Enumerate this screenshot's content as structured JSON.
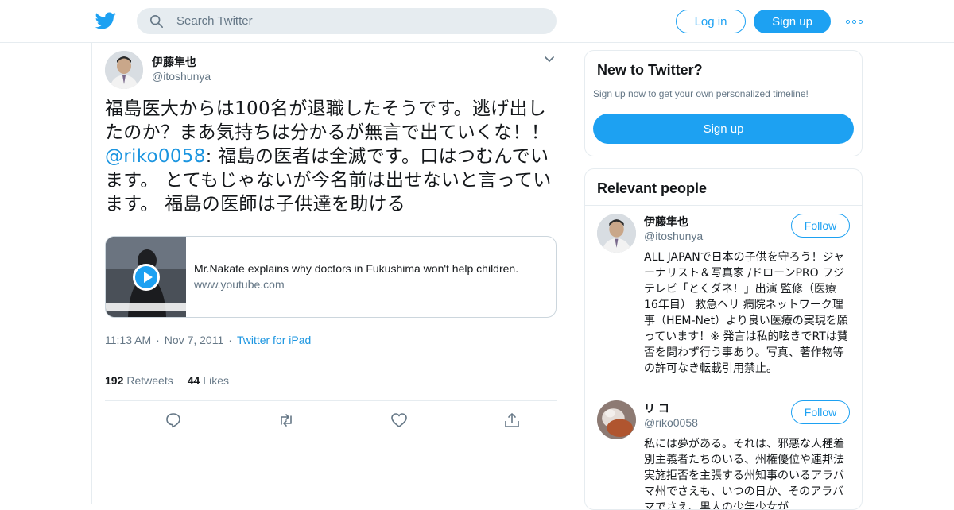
{
  "header": {
    "search_placeholder": "Search Twitter",
    "login_label": "Log in",
    "signup_label": "Sign up",
    "brand_color": "#1da1f2"
  },
  "tweet": {
    "author_name": "伊藤隼也",
    "author_handle": "@itoshunya",
    "text_before": "福島医大からは100名が退職したそうです。逃げ出したのか？まあ気持ちは分かるが無言で出ていくな！！ ",
    "mention": "@riko0058",
    "text_after": ": 福島の医者は全滅です。口はつむんでいます。 とてもじゃないが今名前は出せないと言っています。 福島の医師は子供達を助ける",
    "card": {
      "title": "Mr.Nakate explains why doctors in Fukushima won't help children.",
      "domain": "www.youtube.com"
    },
    "time": "11:13 AM",
    "date": "Nov 7, 2011",
    "source": "Twitter for iPad",
    "retweets_count": "192",
    "retweets_label": "Retweets",
    "likes_count": "44",
    "likes_label": "Likes"
  },
  "sidebar": {
    "new_title": "New to Twitter?",
    "new_text": "Sign up now to get your own personalized timeline!",
    "new_signup": "Sign up",
    "relevant_title": "Relevant people",
    "people": [
      {
        "name": "伊藤隼也",
        "handle": "@itoshunya",
        "follow": "Follow",
        "bio": "ALL JAPANで日本の子供を守ろう！ジャーナリスト＆写真家 /ドローンPRO フジテレビ「とくダネ！」出演 監修（医療 16年目） 救急ヘリ 病院ネットワーク理事（HEM-Net）より良い医療の実現を願っています！※ 発言は私的呟きでRTは賛否を問わず行う事あり。写真、著作物等の許可なき転載引用禁止。"
      },
      {
        "name": "リ コ",
        "handle": "@riko0058",
        "follow": "Follow",
        "bio": "私には夢がある。それは、邪悪な人種差別主義者たちのいる、州権優位や連邦法実施拒否を主張する州知事のいるアラバマ州でさえも、いつの日か、そのアラバマでさえ、黒人の少年少女が"
      }
    ]
  }
}
